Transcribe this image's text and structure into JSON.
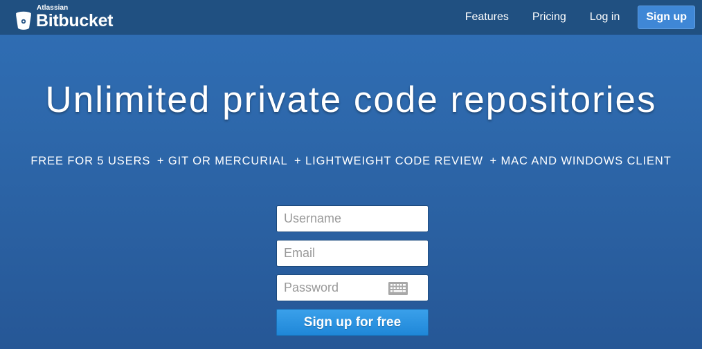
{
  "header": {
    "brand_small": "Atlassian",
    "brand_name": "Bitbucket",
    "nav": {
      "features": "Features",
      "pricing": "Pricing",
      "login": "Log in",
      "signup": "Sign up"
    }
  },
  "hero": {
    "title": "Unlimited private code repositories",
    "features": [
      "FREE FOR 5 USERS",
      "+ GIT OR MERCURIAL",
      "+ LIGHTWEIGHT CODE REVIEW",
      "+ MAC AND WINDOWS CLIENT"
    ]
  },
  "form": {
    "username_placeholder": "Username",
    "email_placeholder": "Email",
    "password_placeholder": "Password",
    "submit_label": "Sign up for free"
  },
  "colors": {
    "header_bg": "#205081",
    "hero_bg": "#2d67aa",
    "primary_button": "#1f87d8"
  },
  "icons": [
    "bitbucket-logo-icon",
    "keyboard-icon"
  ]
}
